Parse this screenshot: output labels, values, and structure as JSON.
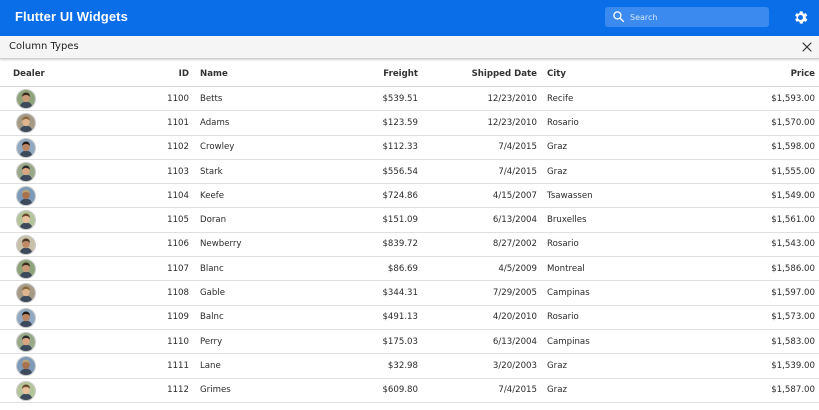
{
  "app": {
    "title": "Flutter UI Widgets",
    "search_placeholder": "Search",
    "accent_color": "#0a6ee8"
  },
  "icons": {
    "search": "search-icon",
    "settings": "gear-icon",
    "close": "close-icon"
  },
  "panel": {
    "title": "Column Types"
  },
  "table": {
    "columns": [
      "Dealer",
      "ID",
      "Name",
      "Freight",
      "Shipped Date",
      "City",
      "Price"
    ],
    "rows": [
      {
        "id": "1100",
        "name": "Betts",
        "freight": "$539.51",
        "shipped": "12/23/2010",
        "city": "Recife",
        "price": "$1,593.00"
      },
      {
        "id": "1101",
        "name": "Adams",
        "freight": "$123.59",
        "shipped": "12/23/2010",
        "city": "Rosario",
        "price": "$1,570.00"
      },
      {
        "id": "1102",
        "name": "Crowley",
        "freight": "$112.33",
        "shipped": "7/4/2015",
        "city": "Graz",
        "price": "$1,598.00"
      },
      {
        "id": "1103",
        "name": "Stark",
        "freight": "$556.54",
        "shipped": "7/4/2015",
        "city": "Graz",
        "price": "$1,555.00"
      },
      {
        "id": "1104",
        "name": "Keefe",
        "freight": "$724.86",
        "shipped": "4/15/2007",
        "city": "Tsawassen",
        "price": "$1,549.00"
      },
      {
        "id": "1105",
        "name": "Doran",
        "freight": "$151.09",
        "shipped": "6/13/2004",
        "city": "Bruxelles",
        "price": "$1,561.00"
      },
      {
        "id": "1106",
        "name": "Newberry",
        "freight": "$839.72",
        "shipped": "8/27/2002",
        "city": "Rosario",
        "price": "$1,543.00"
      },
      {
        "id": "1107",
        "name": "Blanc",
        "freight": "$86.69",
        "shipped": "4/5/2009",
        "city": "Montreal",
        "price": "$1,586.00"
      },
      {
        "id": "1108",
        "name": "Gable",
        "freight": "$344.31",
        "shipped": "7/29/2005",
        "city": "Campinas",
        "price": "$1,597.00"
      },
      {
        "id": "1109",
        "name": "Balnc",
        "freight": "$491.13",
        "shipped": "4/20/2010",
        "city": "Rosario",
        "price": "$1,573.00"
      },
      {
        "id": "1110",
        "name": "Perry",
        "freight": "$175.03",
        "shipped": "6/13/2004",
        "city": "Campinas",
        "price": "$1,583.00"
      },
      {
        "id": "1111",
        "name": "Lane",
        "freight": "$32.98",
        "shipped": "3/20/2003",
        "city": "Graz",
        "price": "$1,539.00"
      },
      {
        "id": "1112",
        "name": "Grimes",
        "freight": "$609.80",
        "shipped": "7/4/2015",
        "city": "Graz",
        "price": "$1,587.00"
      }
    ]
  }
}
